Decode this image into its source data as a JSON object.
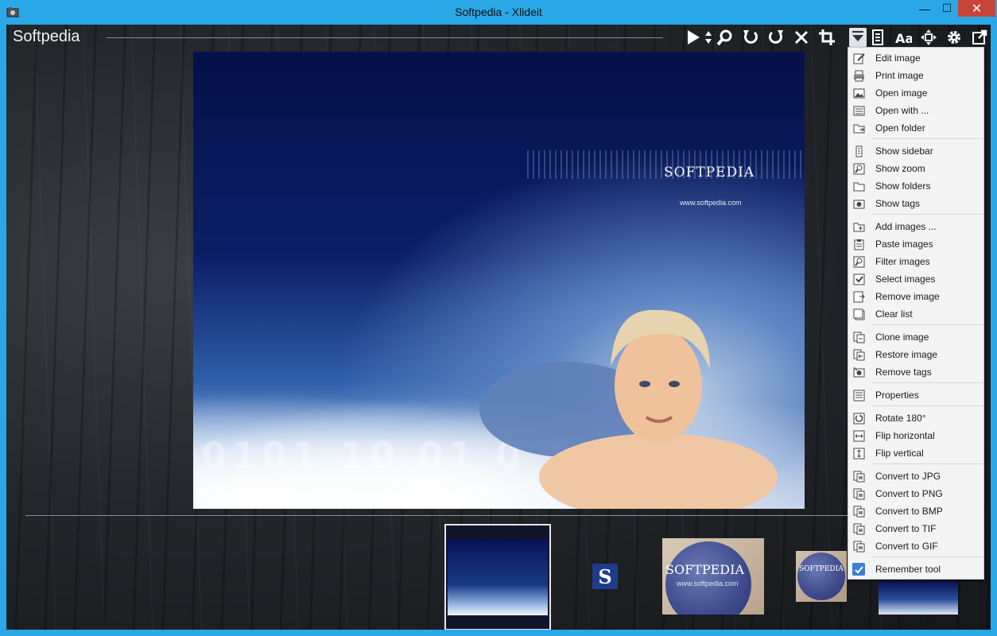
{
  "window": {
    "title": "Softpedia - Xlideit",
    "minimize": "—",
    "maximize": "☐",
    "close": "✕"
  },
  "brand": {
    "label": "Softpedia"
  },
  "main_image": {
    "logo_text": "SOFTPEDIA",
    "url_text": "www.softpedia.com",
    "digits": "0101 10 01 0 10 01"
  },
  "thumbnails": {
    "thumb2_letter": "S",
    "thumb3_title": "SOFTPEDIA",
    "thumb3_url": "www.softpedia.com",
    "thumb4_title": "SOFTPEDIA"
  },
  "menu": {
    "items": [
      {
        "label": "Edit image",
        "icon": "edit-icon"
      },
      {
        "label": "Print image",
        "icon": "print-icon"
      },
      {
        "label": "Open image",
        "icon": "image-icon"
      },
      {
        "label": "Open with ...",
        "icon": "list-icon"
      },
      {
        "label": "Open folder",
        "icon": "folder-open-icon"
      },
      {
        "label": "Show sidebar",
        "icon": "sidebar-icon"
      },
      {
        "label": "Show zoom",
        "icon": "zoom-icon"
      },
      {
        "label": "Show folders",
        "icon": "folder-icon"
      },
      {
        "label": "Show tags",
        "icon": "camera-icon"
      },
      {
        "label": "Add images ...",
        "icon": "add-images-icon"
      },
      {
        "label": "Paste images",
        "icon": "paste-icon"
      },
      {
        "label": "Filter images",
        "icon": "filter-icon"
      },
      {
        "label": "Select images",
        "icon": "checkbox-icon"
      },
      {
        "label": "Remove image",
        "icon": "remove-image-icon"
      },
      {
        "label": "Clear list",
        "icon": "clear-icon"
      },
      {
        "label": "Clone image",
        "icon": "clone-icon"
      },
      {
        "label": "Restore image",
        "icon": "restore-icon"
      },
      {
        "label": "Remove tags",
        "icon": "remove-tags-icon"
      },
      {
        "label": "Properties",
        "icon": "properties-icon"
      },
      {
        "label": "Rotate 180°",
        "icon": "rotate-icon"
      },
      {
        "label": "Flip horizontal",
        "icon": "flip-horizontal-icon"
      },
      {
        "label": "Flip vertical",
        "icon": "flip-vertical-icon"
      },
      {
        "label": "Convert to JPG",
        "icon": "convert-icon"
      },
      {
        "label": "Convert to PNG",
        "icon": "convert-icon"
      },
      {
        "label": "Convert to BMP",
        "icon": "convert-icon"
      },
      {
        "label": "Convert to TIF",
        "icon": "convert-icon"
      },
      {
        "label": "Convert to GIF",
        "icon": "convert-icon"
      },
      {
        "label": "Remember tool",
        "icon": "checkmark-icon",
        "checked": true
      }
    ]
  },
  "colors": {
    "titlebar": "#2aa7e6",
    "close_button": "#c7463b",
    "menu_background": "#f4f4f4",
    "check_highlight": "#3b7fd1"
  }
}
